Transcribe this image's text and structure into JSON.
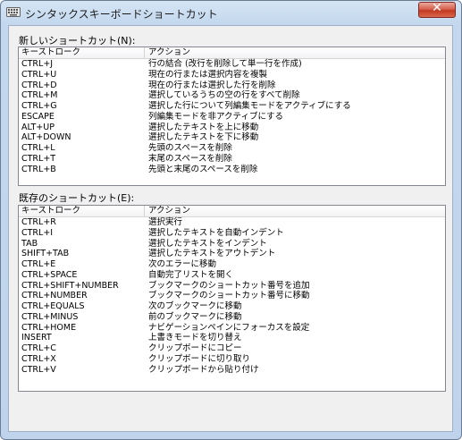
{
  "window": {
    "title": "シンタックスキーボードショートカット",
    "close_symbol": "✕"
  },
  "new_section": {
    "label": "新しいショートカット(N):",
    "headers": {
      "key": "キーストローク",
      "action": "アクション"
    },
    "rows": [
      {
        "key": "CTRL+J",
        "action": "行の結合 (改行を削除して単一行を作成)"
      },
      {
        "key": "CTRL+U",
        "action": "現在の行または選択内容を複製"
      },
      {
        "key": "CTRL+D",
        "action": "現在の行または選択した行を削除"
      },
      {
        "key": "CTRL+M",
        "action": "選択しているうちの空の行をすべて削除"
      },
      {
        "key": "CTRL+G",
        "action": "選択した行について列編集モードをアクティブにする"
      },
      {
        "key": "ESCAPE",
        "action": "列編集モードを非アクティブにする"
      },
      {
        "key": "ALT+UP",
        "action": "選択したテキストを上に移動"
      },
      {
        "key": "ALT+DOWN",
        "action": "選択したテキストを下に移動"
      },
      {
        "key": "CTRL+L",
        "action": "先頭のスペースを削除"
      },
      {
        "key": "CTRL+T",
        "action": "末尾のスペースを削除"
      },
      {
        "key": "CTRL+B",
        "action": "先頭と末尾のスペースを削除"
      }
    ]
  },
  "existing_section": {
    "label": "既存のショートカット(E):",
    "headers": {
      "key": "キーストローク",
      "action": "アクション"
    },
    "rows": [
      {
        "key": "CTRL+R",
        "action": "選択実行"
      },
      {
        "key": "CTRL+I",
        "action": "選択したテキストを自動インデント"
      },
      {
        "key": "TAB",
        "action": "選択したテキストをインデント"
      },
      {
        "key": "SHIFT+TAB",
        "action": "選択したテキストをアウトデント"
      },
      {
        "key": "CTRL+E",
        "action": "次のエラーに移動"
      },
      {
        "key": "CTRL+SPACE",
        "action": "自動完了リストを開く"
      },
      {
        "key": "CTRL+SHIFT+NUMBER",
        "action": "ブックマークのショートカット番号を追加"
      },
      {
        "key": "CTRL+NUMBER",
        "action": "ブックマークのショートカット番号に移動"
      },
      {
        "key": "CTRL+EQUALS",
        "action": "次のブックマークに移動"
      },
      {
        "key": "CTRL+MINUS",
        "action": "前のブックマークに移動"
      },
      {
        "key": "CTRL+HOME",
        "action": "ナビゲーションペインにフォーカスを設定"
      },
      {
        "key": "INSERT",
        "action": "上書きモードを切り替え"
      },
      {
        "key": "CTRL+C",
        "action": "クリップボードにコピー"
      },
      {
        "key": "CTRL+X",
        "action": "クリップボードに切り取り"
      },
      {
        "key": "CTRL+V",
        "action": "クリップボードから貼り付け"
      }
    ]
  }
}
